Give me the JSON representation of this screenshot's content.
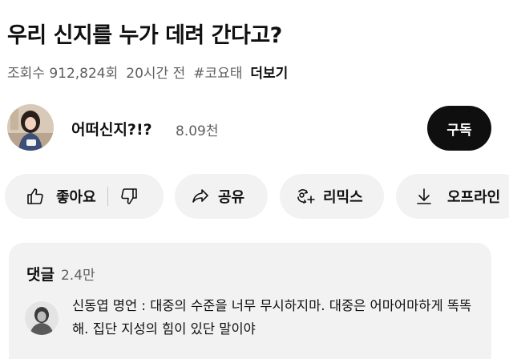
{
  "video": {
    "title": "우리 신지를 누가 데려 간다고?",
    "views": "조회수 912,824회",
    "age": "20시간 전",
    "hashtag": "#코요태",
    "more_label": "더보기"
  },
  "channel": {
    "name": "어떠신지?!?",
    "subscribers": "8.09천",
    "subscribe_label": "구독"
  },
  "actions": {
    "like_label": "좋아요",
    "share_label": "공유",
    "remix_label": "리믹스",
    "offline_label": "오프라인"
  },
  "comments": {
    "title": "댓글",
    "count": "2.4만",
    "top_comment": "신동엽 명언 : 대중의 수준을 너무 무시하지마. 대중은 어마어마하게 똑똑해. 집단 지성의 힘이 있단 말이야"
  },
  "colors": {
    "primary_text": "#0f0f0f",
    "secondary_text": "#606060",
    "pill_bg": "#f2f2f2",
    "subscribe_bg": "#0f0f0f"
  },
  "icons": {
    "like": "thumbs-up-icon",
    "dislike": "thumbs-down-icon",
    "share": "share-arrow-icon",
    "remix": "remix-icon",
    "offline": "download-icon"
  }
}
